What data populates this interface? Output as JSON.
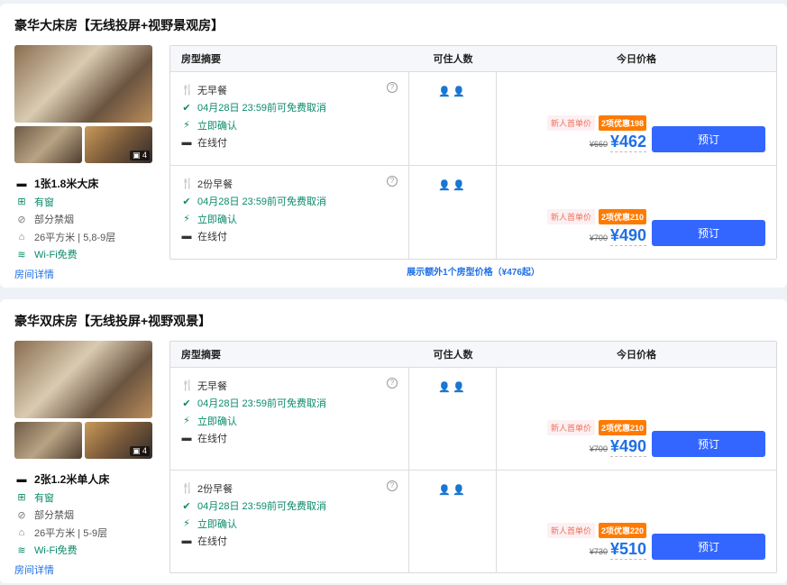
{
  "table_headers": {
    "summary": "房型摘要",
    "guests": "可住人数",
    "price": "今日价格"
  },
  "book_label": "预订",
  "colors": {
    "accent": "#3366ff",
    "price": "#1f6fe6",
    "green": "#0a8a6a",
    "promo": "#ff7a00"
  },
  "rooms": [
    {
      "title": "豪华大床房【无线投屏+视野景观房】",
      "photo_count": "4",
      "bed": "1张1.8米大床",
      "window": "有窗",
      "smoking": "部分禁烟",
      "area_floor": "26平方米 | 5,8-9层",
      "wifi": "Wi-Fi免费",
      "details_link": "房间详情",
      "more_link": "展示额外1个房型价格（¥476起）",
      "plans": [
        {
          "meal": "无早餐",
          "cancel": "04月28日 23:59前可免费取消",
          "confirm": "立即确认",
          "pay": "在线付",
          "guests": "👤👤",
          "tag1": "新人首单价",
          "tag2": "2项优惠198",
          "orig": "¥660",
          "price": "¥462"
        },
        {
          "meal": "2份早餐",
          "cancel": "04月28日 23:59前可免费取消",
          "confirm": "立即确认",
          "pay": "在线付",
          "guests": "👤👤",
          "tag1": "新人首单价",
          "tag2": "2项优惠210",
          "orig": "¥700",
          "price": "¥490"
        }
      ]
    },
    {
      "title": "豪华双床房【无线投屏+视野观景】",
      "photo_count": "4",
      "bed": "2张1.2米单人床",
      "window": "有窗",
      "smoking": "部分禁烟",
      "area_floor": "26平方米 | 5-9层",
      "wifi": "Wi-Fi免费",
      "details_link": "房间详情",
      "plans": [
        {
          "meal": "无早餐",
          "cancel": "04月28日 23:59前可免费取消",
          "confirm": "立即确认",
          "pay": "在线付",
          "guests": "👤👤",
          "tag1": "新人首单价",
          "tag2": "2项优惠210",
          "orig": "¥700",
          "price": "¥490"
        },
        {
          "meal": "2份早餐",
          "cancel": "04月28日 23:59前可免费取消",
          "confirm": "立即确认",
          "pay": "在线付",
          "guests": "👤👤",
          "tag1": "新人首单价",
          "tag2": "2项优惠220",
          "orig": "¥730",
          "price": "¥510"
        }
      ]
    }
  ]
}
